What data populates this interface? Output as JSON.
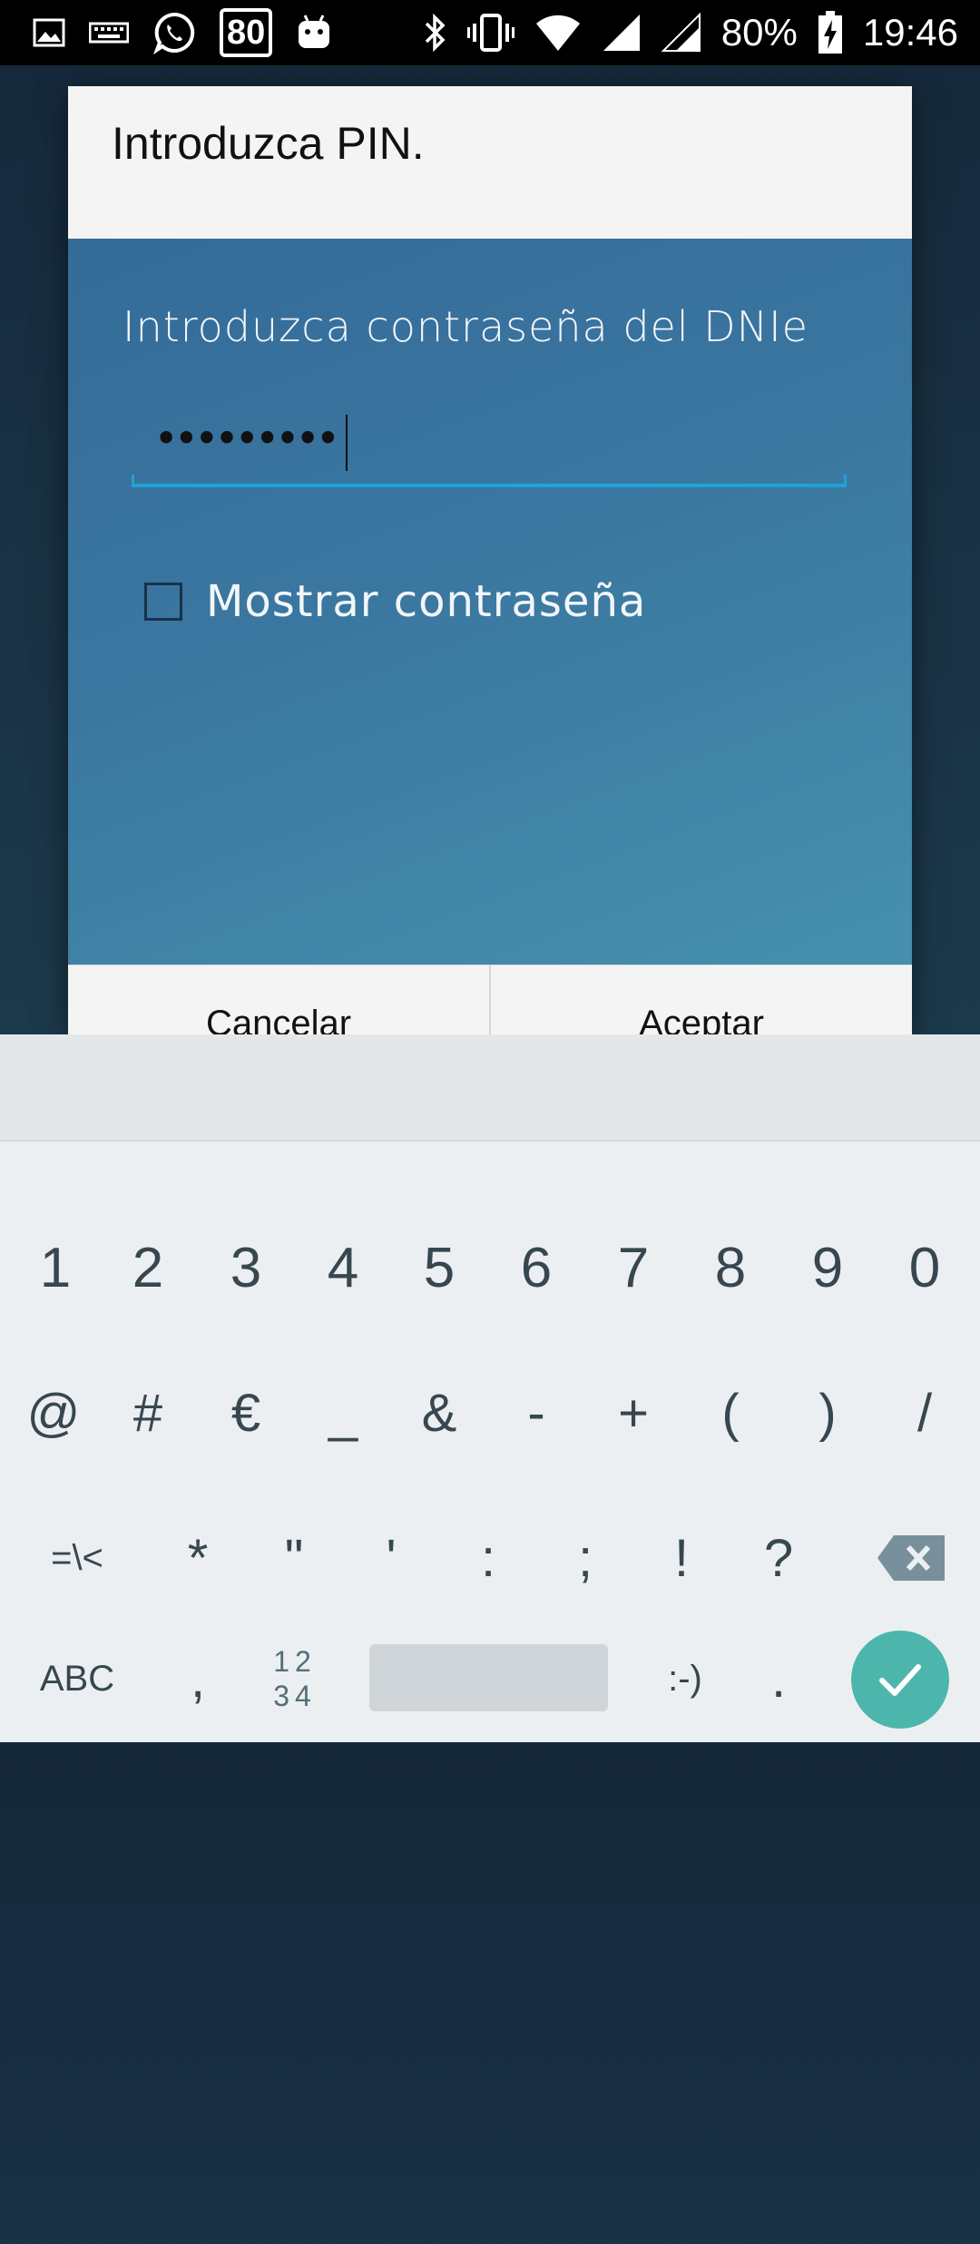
{
  "status_bar": {
    "left_icons": [
      "image-icon",
      "keyboard-icon",
      "whatsapp-icon",
      "badge-80-icon",
      "android-icon"
    ],
    "badge_text": "80",
    "right_icons": [
      "bluetooth-icon",
      "vibrate-icon",
      "wifi-icon",
      "signal-icon",
      "signal-icon-2",
      "battery-charging-icon"
    ],
    "battery": "80%",
    "time": "19:46"
  },
  "dialog": {
    "title": "Introduzca PIN.",
    "prompt": "Introduzca contraseña del DNIe",
    "pin_masked": "•••••••••",
    "show_password_label": "Mostrar contraseña",
    "show_password_checked": false,
    "cancel_label": "Cancelar",
    "accept_label": "Aceptar"
  },
  "keyboard": {
    "row1": [
      "1",
      "2",
      "3",
      "4",
      "5",
      "6",
      "7",
      "8",
      "9",
      "0"
    ],
    "row2": [
      "@",
      "#",
      "€",
      "_",
      "&",
      "-",
      "+",
      "(",
      ")",
      "/"
    ],
    "row3": [
      "=\\<",
      "*",
      "\"",
      "'",
      ":",
      ";",
      "!",
      "?"
    ],
    "row4": {
      "abc": "ABC",
      "comma": ",",
      "num_top": "12",
      "num_bottom": "34",
      "smiley": ":-)",
      "period": "."
    },
    "accent_color": "#4db6ac"
  }
}
